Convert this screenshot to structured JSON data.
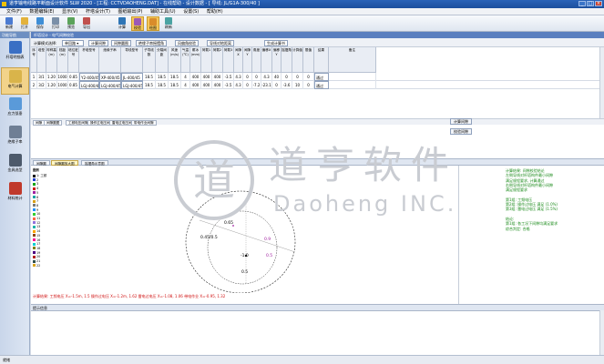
{
  "window": {
    "title": "道亨输电线路平断面设计软件 SLW 2020 - [工程: CCTVDAOHENG.DAT] - 在线帮助 - 设计数据 - [ 导线: JL/G1A-300/40 ]",
    "controls": [
      "_",
      "□",
      "×"
    ]
  },
  "menu": [
    "文件(F)",
    "数据编辑(E)",
    "显示(V)",
    "杆塔设计(T)",
    "图纸输出(P)",
    "辅助工具(U)",
    "设置(S)",
    "帮助(H)"
  ],
  "toolbar": [
    {
      "label": "新建",
      "color": "#4b7bd1"
    },
    {
      "label": "打开",
      "color": "#e3b23c"
    },
    {
      "label": "保存",
      "color": "#3e8ed6"
    },
    {
      "label": "打印",
      "color": "#7a8fa8"
    },
    {
      "label": "预览",
      "color": "#5ba35b"
    },
    {
      "label": "导出",
      "color": "#c0504d"
    },
    {
      "label": "计算",
      "color": "#2e75b6"
    },
    {
      "label": "校验",
      "color": "#9b59b6"
    },
    {
      "label": "绘图",
      "color": "#d98c2b"
    },
    {
      "label": "刷新",
      "color": "#4aa3a3"
    }
  ],
  "sidebar": {
    "header": "功能导航",
    "items": [
      {
        "label": "杆塔明细表",
        "icon": "tower-table-icon",
        "color": "#3a6fc4"
      },
      {
        "label": "电气计算",
        "icon": "electric-calc-icon",
        "color": "#d9b44a"
      },
      {
        "label": "应力弧垂",
        "icon": "sag-tension-icon",
        "color": "#5a9ad9"
      },
      {
        "label": "绝缘子串",
        "icon": "insulator-icon",
        "color": "#6f7f95"
      },
      {
        "label": "金具选型",
        "icon": "fitting-icon",
        "color": "#4d5a6b"
      },
      {
        "label": "材料统计",
        "icon": "material-stats-icon",
        "color": "#c0392b"
      }
    ]
  },
  "main": {
    "tab": "杆塔设计 - 电气间隙校验",
    "filter": {
      "label": "计算模式选择:",
      "mode": "单回路",
      "buttons": [
        "计算间隙",
        "间隙圆图",
        "绝缘子串摇摆角",
        "风偏角校验",
        "导线对地距离"
      ],
      "extra": "生成计算书"
    },
    "columns": [
      "序号",
      "塔型",
      "呼称高(m)",
      "档距(m)",
      "塔位桩号",
      "杆塔型号",
      "绝缘子串",
      "导线型号",
      "子导线数",
      "分裂间距",
      "风速(m/s)",
      "气温(℃)",
      "覆冰(mm)",
      "荷载1",
      "荷载2",
      "荷载3",
      "间隙X",
      "间隙Y",
      "角度",
      "偏移X",
      "偏移Y",
      "摇摆角",
      "计算值",
      "限值",
      "结果",
      "备注"
    ],
    "rows": [
      [
        "1",
        "3/1",
        "1.20",
        "1000",
        "0.85",
        "Y2-400/45",
        "XP-400/45",
        "JL-400/45",
        "18.5",
        "18.5",
        "18.5",
        "4",
        "400",
        "400",
        "400",
        "-3.5",
        "4.3",
        "0",
        "0",
        "4.3",
        "40",
        "0",
        "0",
        "0",
        "通过",
        ""
      ],
      [
        "2",
        "3/2",
        "1.20",
        "1000",
        "0.85",
        "LGJ-400/45",
        "LGJ-400/45",
        "LGJ-400/45",
        "18.5",
        "18.5",
        "18.5",
        "4",
        "400",
        "400",
        "400",
        "-3.5",
        "4.3",
        "0",
        "-7.2",
        "-23.1",
        "0",
        "-3.6",
        "10",
        "0",
        "通过",
        ""
      ]
    ],
    "subtabs_top": [
      "间隙",
      "间隙圆图",
      "工频电压间隙",
      "操作过电压间隙",
      "雷电过电压间隙",
      "带电作业间隙"
    ],
    "right_buttons": [
      "计算间隙",
      "校验间隙"
    ],
    "diagram_tabs": [
      "间隙圆",
      "间隙圆放大图",
      "摇摆角示意图"
    ],
    "legend_title": "图例",
    "legend": [
      {
        "label": "1: 工频",
        "color": "#0a0a0a"
      },
      {
        "label": "2",
        "color": "#1e3fd1"
      },
      {
        "label": "3",
        "color": "#18a418"
      },
      {
        "label": "4",
        "color": "#d01818"
      },
      {
        "label": "5",
        "color": "#a020a0"
      },
      {
        "label": "6",
        "color": "#1aa3a3"
      },
      {
        "label": "7",
        "color": "#d9a01a"
      },
      {
        "label": "8",
        "color": "#777777"
      },
      {
        "label": "9",
        "color": "#1e90ff"
      },
      {
        "label": "10",
        "color": "#32cd32"
      },
      {
        "label": "11",
        "color": "#ff6347"
      },
      {
        "label": "12",
        "color": "#9370db"
      },
      {
        "label": "13",
        "color": "#20b2aa"
      },
      {
        "label": "14",
        "color": "#ffa500"
      },
      {
        "label": "15",
        "color": "#8b4513"
      },
      {
        "label": "16",
        "color": "#ff1493"
      },
      {
        "label": "17",
        "color": "#00ced1"
      },
      {
        "label": "18",
        "color": "#808000"
      },
      {
        "label": "19",
        "color": "#4b0082"
      },
      {
        "label": "20",
        "color": "#b22222"
      },
      {
        "label": "21",
        "color": "#2f4f4f"
      },
      {
        "label": "22",
        "color": "#daa520"
      }
    ],
    "diagram_labels": [
      "0.45/0.5",
      "0.9",
      "-1.0",
      "0.5",
      "0.65",
      "0.5"
    ],
    "status_red": "计算结果: 工频电压 X=-1.5m, 1.5  操作过电压 X=-1.2m, 1.62  雷电过电压 X=-1.08, 1.06  带电作业 X=-0.95, 1.32",
    "results": [
      "计算结果: 间隙校验结论",
      "左侧导线对杆塔构件最小间隙",
      "满足规程要求, 计算通过",
      "右侧导线对杆塔构件最小间隙",
      "满足规程要求",
      "",
      "第1组: 工频电压",
      "第2组: 操作过电压 满足 (1.0%)",
      "第3组: 雷电过电压 满足 (1.5%)",
      "",
      "结论:",
      "第1组: 各工况下间隙均满足要求",
      "综合判定: 合格"
    ],
    "bottom_header": "提示信息"
  },
  "watermark": {
    "brand": "道亨软件",
    "brand_en": "Daoheng INC.",
    "mark": "道",
    "color": "#c9ccd2"
  },
  "statusbar": "就绪"
}
